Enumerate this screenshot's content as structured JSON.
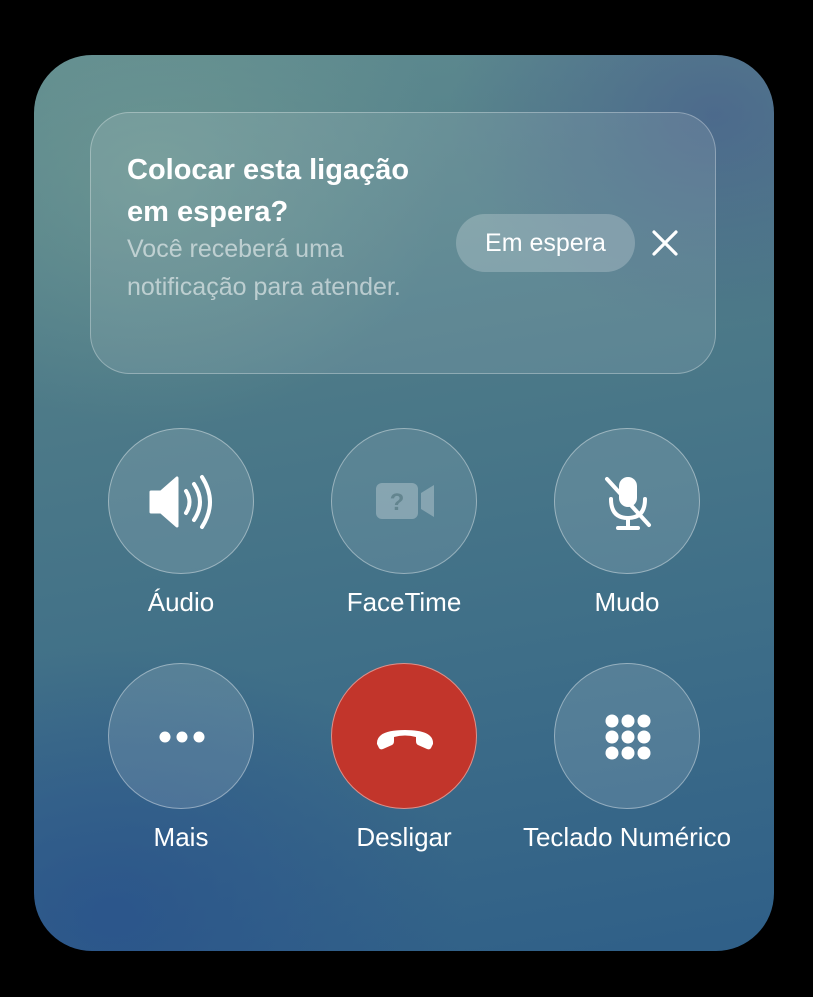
{
  "banner": {
    "title": "Colocar esta ligação em espera?",
    "subtitle": "Você receberá uma notificação para atender.",
    "hold_button": "Em espera",
    "close_icon": "xmark-icon"
  },
  "controls": [
    {
      "label": "Áudio",
      "icon": "speaker-wave-icon",
      "enabled": true
    },
    {
      "label": "FaceTime",
      "icon": "facetime-unknown-icon",
      "enabled": false
    },
    {
      "label": "Mudo",
      "icon": "mic-slash-icon",
      "enabled": true
    },
    {
      "label": "Mais",
      "icon": "ellipsis-icon",
      "enabled": true
    },
    {
      "label": "Desligar",
      "icon": "phone-down-icon",
      "enabled": true
    },
    {
      "label": "Teclado Numérico",
      "icon": "keypad-grid-icon",
      "enabled": true
    }
  ],
  "colors": {
    "hangup": "#c2352b",
    "background_top": "#5f8b8f",
    "background_bottom": "#2f5f88"
  }
}
